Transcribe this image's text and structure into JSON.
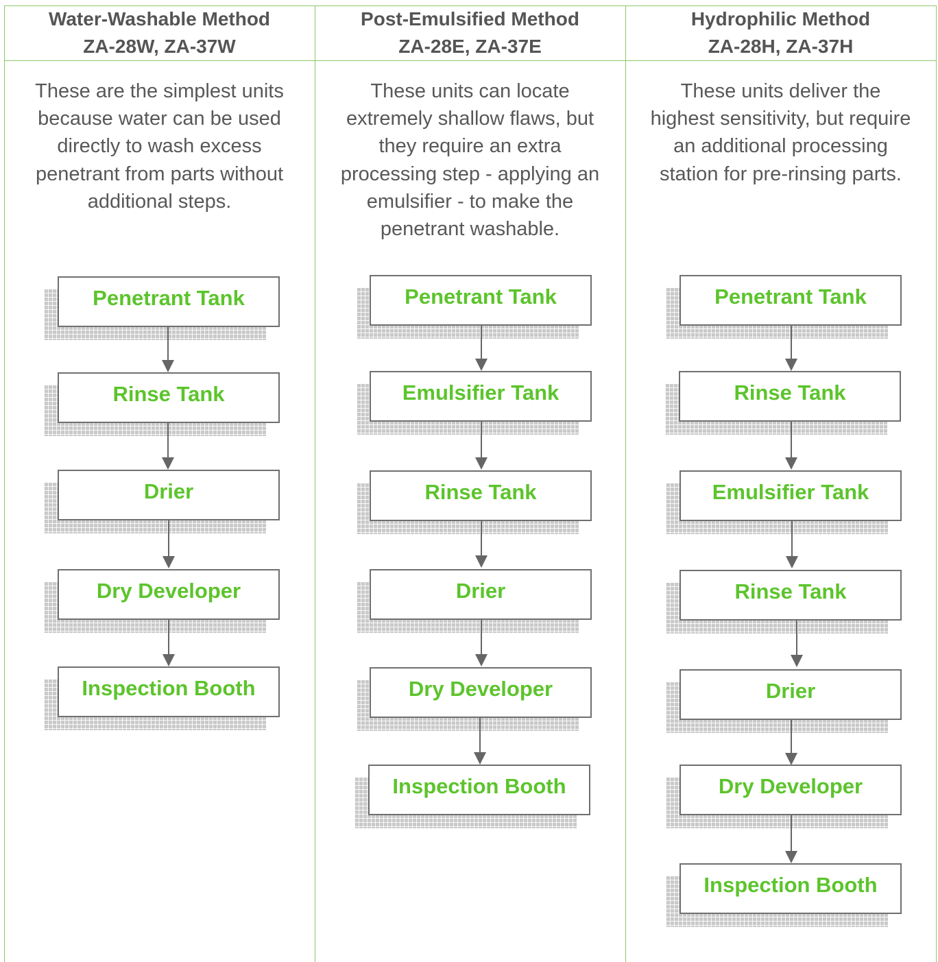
{
  "columns": [
    {
      "title": "Water-Washable Method",
      "models": "ZA-28W, ZA-37W",
      "description": [
        "These are the simplest units",
        "because water can be used",
        "directly to wash excess",
        "penetrant from parts without",
        "additional steps."
      ],
      "steps": [
        "Penetrant Tank",
        "Rinse Tank",
        "Drier",
        "Dry Developer",
        "Inspection Booth"
      ]
    },
    {
      "title": "Post-Emulsified Method",
      "models": "ZA-28E, ZA-37E",
      "description": [
        "These units can locate",
        "extremely shallow flaws, but",
        "they require an extra",
        "processing step - applying an",
        "emulsifier - to make the",
        "penetrant washable."
      ],
      "steps": [
        "Penetrant Tank",
        "Emulsifier Tank",
        "Rinse Tank",
        "Drier",
        "Dry Developer",
        "Inspection Booth"
      ]
    },
    {
      "title": "Hydrophilic Method",
      "models": "ZA-28H, ZA-37H",
      "description": [
        "These units deliver the",
        "highest sensitivity, but require",
        "an additional processing",
        "station for pre-rinsing parts."
      ],
      "steps": [
        "Penetrant Tank",
        "Rinse Tank",
        "Emulsifier Tank",
        "Rinse Tank",
        "Drier",
        "Dry Developer",
        "Inspection Booth"
      ]
    }
  ],
  "colors": {
    "border": "#8cc86a",
    "box_text": "#5cc42c",
    "header_text": "#555555",
    "body_text": "#585858"
  }
}
